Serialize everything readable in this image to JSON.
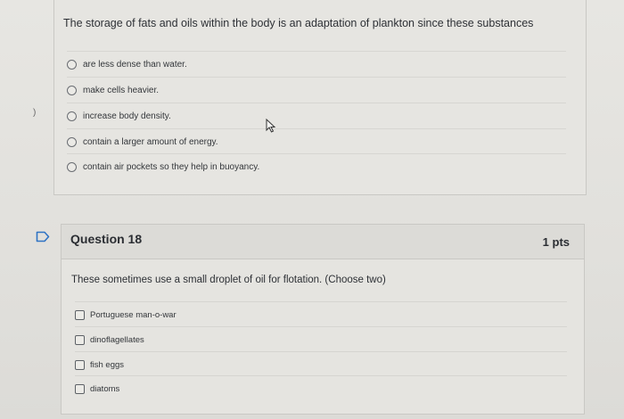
{
  "question17": {
    "prompt": "The storage of fats and oils within the body is an adaptation of plankton since these substances",
    "answers": [
      "are less dense than water.",
      "make cells heavier.",
      "increase body density.",
      "contain a larger amount of energy.",
      "contain air pockets so they help in buoyancy."
    ]
  },
  "stray_mark": ")",
  "question18": {
    "title": "Question 18",
    "points": "1 pts",
    "prompt": "These sometimes use a small droplet of oil for flotation. (Choose two)",
    "choices": [
      "Portuguese man-o-war",
      "dinoflagellates",
      "fish eggs",
      "diatoms"
    ]
  }
}
